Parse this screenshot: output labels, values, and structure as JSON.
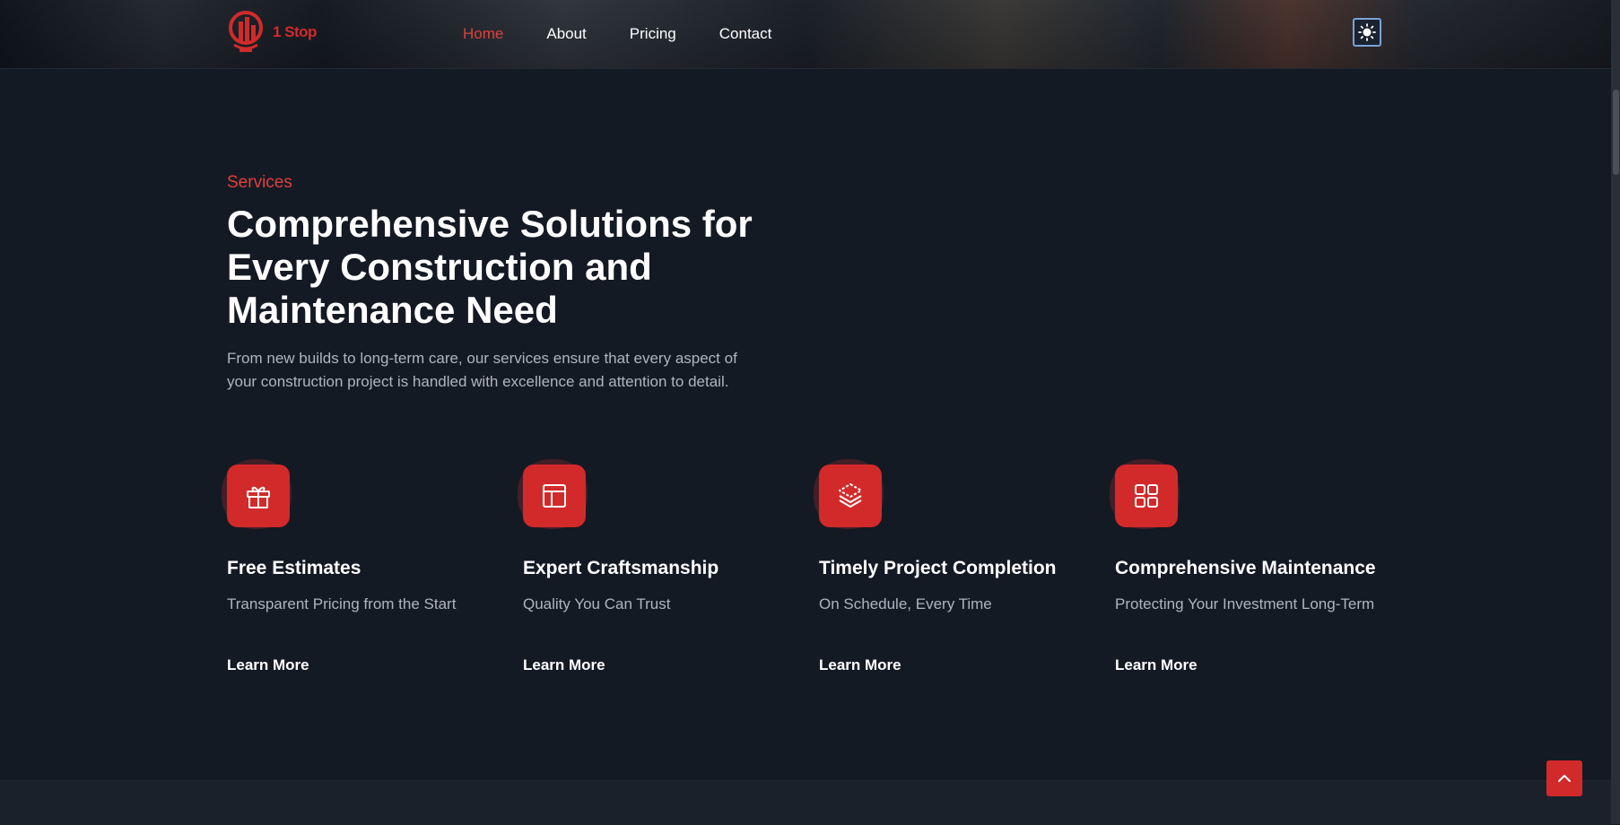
{
  "header": {
    "logo_text": "1 Stop",
    "nav": [
      {
        "label": "Home",
        "active": true
      },
      {
        "label": "About",
        "active": false
      },
      {
        "label": "Pricing",
        "active": false
      },
      {
        "label": "Contact",
        "active": false
      }
    ],
    "theme_toggle_icon": "sun-icon"
  },
  "section": {
    "eyebrow": "Services",
    "headline": "Comprehensive Solutions for Every Construction and Maintenance Need",
    "description": "From new builds to long-term care, our services ensure that every aspect of your construction project is handled with excellence and attention to detail."
  },
  "services": [
    {
      "icon": "gift-icon",
      "title": "Free Estimates",
      "subtitle": "Transparent Pricing from the Start",
      "link": "Learn More"
    },
    {
      "icon": "layout-icon",
      "title": "Expert Craftsmanship",
      "subtitle": "Quality You Can Trust",
      "link": "Learn More"
    },
    {
      "icon": "layers-icon",
      "title": "Timely Project Completion",
      "subtitle": "On Schedule, Every Time",
      "link": "Learn More"
    },
    {
      "icon": "grid-icon",
      "title": "Comprehensive Maintenance",
      "subtitle": "Protecting Your Investment Long-Term",
      "link": "Learn More"
    }
  ],
  "colors": {
    "accent": "#d22a2a",
    "background": "#141a24",
    "muted_text": "#aeb5c0"
  },
  "scroll_top_icon": "chevron-up-icon"
}
